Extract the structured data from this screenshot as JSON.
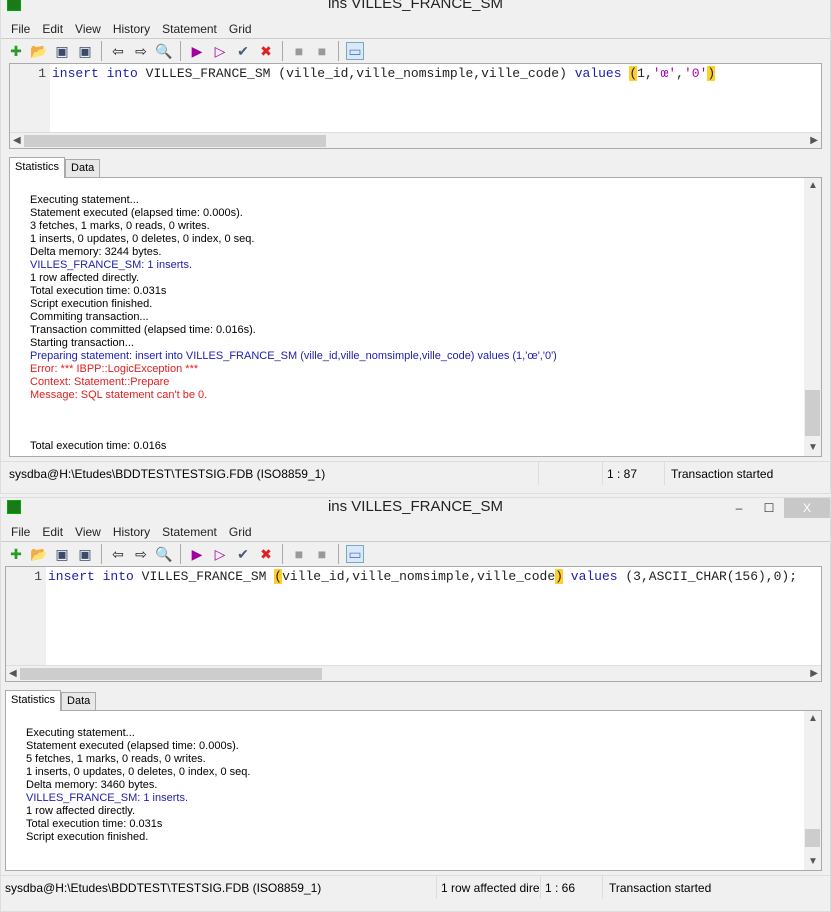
{
  "windows": [
    {
      "title": "ins VILLES_FRANCE_SM",
      "menu": [
        "File",
        "Edit",
        "View",
        "History",
        "Statement",
        "Grid"
      ],
      "line_number": "1",
      "sql": [
        {
          "t": "insert",
          "k": "kw"
        },
        {
          "t": " "
        },
        {
          "t": "into",
          "k": "kw"
        },
        {
          "t": " VILLES_FRANCE_SM (ville_id,ville_nomsimple,ville_code) "
        },
        {
          "t": "values",
          "k": "kw"
        },
        {
          "t": " "
        },
        {
          "t": "(",
          "k": "hl"
        },
        {
          "t": "1,"
        },
        {
          "t": "'œ'",
          "k": "str"
        },
        {
          "t": ","
        },
        {
          "t": "'0'",
          "k": "str"
        },
        {
          "t": ")",
          "k": "hl"
        }
      ],
      "tabs": [
        "Statistics",
        "Data"
      ],
      "log": [
        {
          "text": "Executing statement..."
        },
        {
          "text": "Statement executed (elapsed time: 0.000s)."
        },
        {
          "text": "3 fetches, 1 marks, 0 reads, 0 writes."
        },
        {
          "text": "1 inserts, 0 updates, 0 deletes, 0 index, 0 seq."
        },
        {
          "text": "Delta memory: 3244 bytes."
        },
        {
          "text": "VILLES_FRANCE_SM: 1 inserts.",
          "color": "#1c1cb0"
        },
        {
          "text": "1 row affected directly."
        },
        {
          "text": "Total execution time: 0.031s"
        },
        {
          "text": "Script execution finished."
        },
        {
          "text": "Commiting transaction..."
        },
        {
          "text": "Transaction committed (elapsed time: 0.016s)."
        },
        {
          "text": "Starting transaction..."
        },
        {
          "text": "Preparing statement: insert into VILLES_FRANCE_SM (ville_id,ville_nomsimple,ville_code) values (1,'œ','0')",
          "color": "#1c1cb0"
        },
        {
          "text": "Error: *** IBPP::LogicException ***",
          "color": "#e02020"
        },
        {
          "text": "Context: Statement::Prepare",
          "color": "#e02020"
        },
        {
          "text": "Message: SQL statement can't be 0.",
          "color": "#e02020"
        },
        {
          "text": "Total execution time: 0.016s"
        }
      ],
      "status": [
        "sysdba@H:\\Etudes\\BDDTEST\\TESTSIG.FDB (ISO8859_1)",
        "",
        "1 : 87",
        "Transaction started"
      ]
    },
    {
      "title": "ins VILLES_FRANCE_SM",
      "menu": [
        "File",
        "Edit",
        "View",
        "History",
        "Statement",
        "Grid"
      ],
      "line_number": "1",
      "sql": [
        {
          "t": "insert",
          "k": "kw"
        },
        {
          "t": " "
        },
        {
          "t": "into",
          "k": "kw"
        },
        {
          "t": " VILLES_FRANCE_SM "
        },
        {
          "t": "(",
          "k": "hl"
        },
        {
          "t": "ville_id,ville_nomsimple,ville_code"
        },
        {
          "t": ")",
          "k": "hl"
        },
        {
          "t": " "
        },
        {
          "t": "values",
          "k": "kw"
        },
        {
          "t": " (3,ASCII_CHAR(156),0);"
        }
      ],
      "tabs": [
        "Statistics",
        "Data"
      ],
      "log": [
        {
          "text": "Executing statement..."
        },
        {
          "text": "Statement executed (elapsed time: 0.000s)."
        },
        {
          "text": "5 fetches, 1 marks, 0 reads, 0 writes."
        },
        {
          "text": "1 inserts, 0 updates, 0 deletes, 0 index, 0 seq."
        },
        {
          "text": "Delta memory: 3460 bytes."
        },
        {
          "text": "VILLES_FRANCE_SM: 1 inserts.",
          "color": "#1c1cb0"
        },
        {
          "text": "1 row affected directly."
        },
        {
          "text": "Total execution time: 0.031s"
        },
        {
          "text": "Script execution finished."
        }
      ],
      "status": [
        "sysdba@H:\\Etudes\\BDDTEST\\TESTSIG.FDB (ISO8859_1)",
        "1 row affected dire",
        "1 : 66",
        "Transaction started"
      ]
    }
  ],
  "window_controls": {
    "minimize": "‒",
    "maximize": "☐",
    "close": "X"
  },
  "toolbar_icons": [
    "new-icon",
    "open-icon",
    "save-icon",
    "save-as-icon",
    "back-icon",
    "forward-icon",
    "search-icon",
    "execute-icon",
    "execute-step-icon",
    "commit-icon",
    "rollback-icon",
    "disabled-1-icon",
    "disabled-2-icon",
    "split-view-icon"
  ]
}
